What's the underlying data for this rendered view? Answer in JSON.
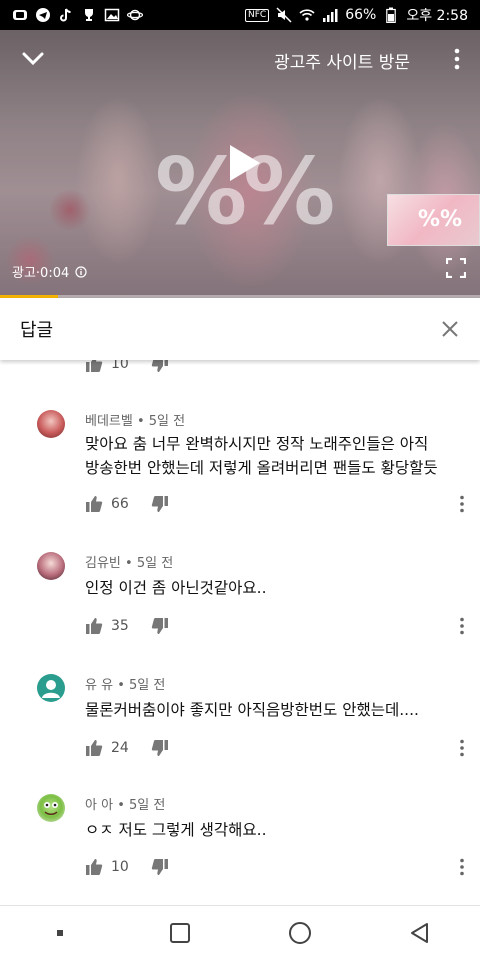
{
  "status_bar": {
    "battery": "66%",
    "time": "오후 2:58",
    "nfc": "NFC"
  },
  "player": {
    "ad_visit_label": "광고주 사이트 방문",
    "ad_time": "광고·0:04",
    "overlay_text": "%%",
    "thumbnail_text": "%%",
    "progress": 0.12
  },
  "replies": {
    "title": "답글",
    "top_partial_likes": "10",
    "comments": [
      {
        "author": "베데르벨",
        "time": "5일 전",
        "text": "맞아요 춤 너무 완벽하시지만 정작 노래주인들은 아직 방송한번 안했는데 저렇게 올려버리면 팬들도 황당할듯",
        "likes": "66"
      },
      {
        "author": "김유빈",
        "time": "5일 전",
        "text": "인정 이건 좀 아닌것같아요..",
        "likes": "35"
      },
      {
        "author": "유 유",
        "time": "5일 전",
        "text": "물론커버춤이야 좋지만   아직음방한번도 안했는데....",
        "likes": "24"
      },
      {
        "author": "아 아",
        "time": "5일 전",
        "text": "ㅇㅈ 저도 그렇게 생각해요..",
        "likes": "10"
      }
    ]
  },
  "icons": {
    "accent": "#f5b400"
  }
}
